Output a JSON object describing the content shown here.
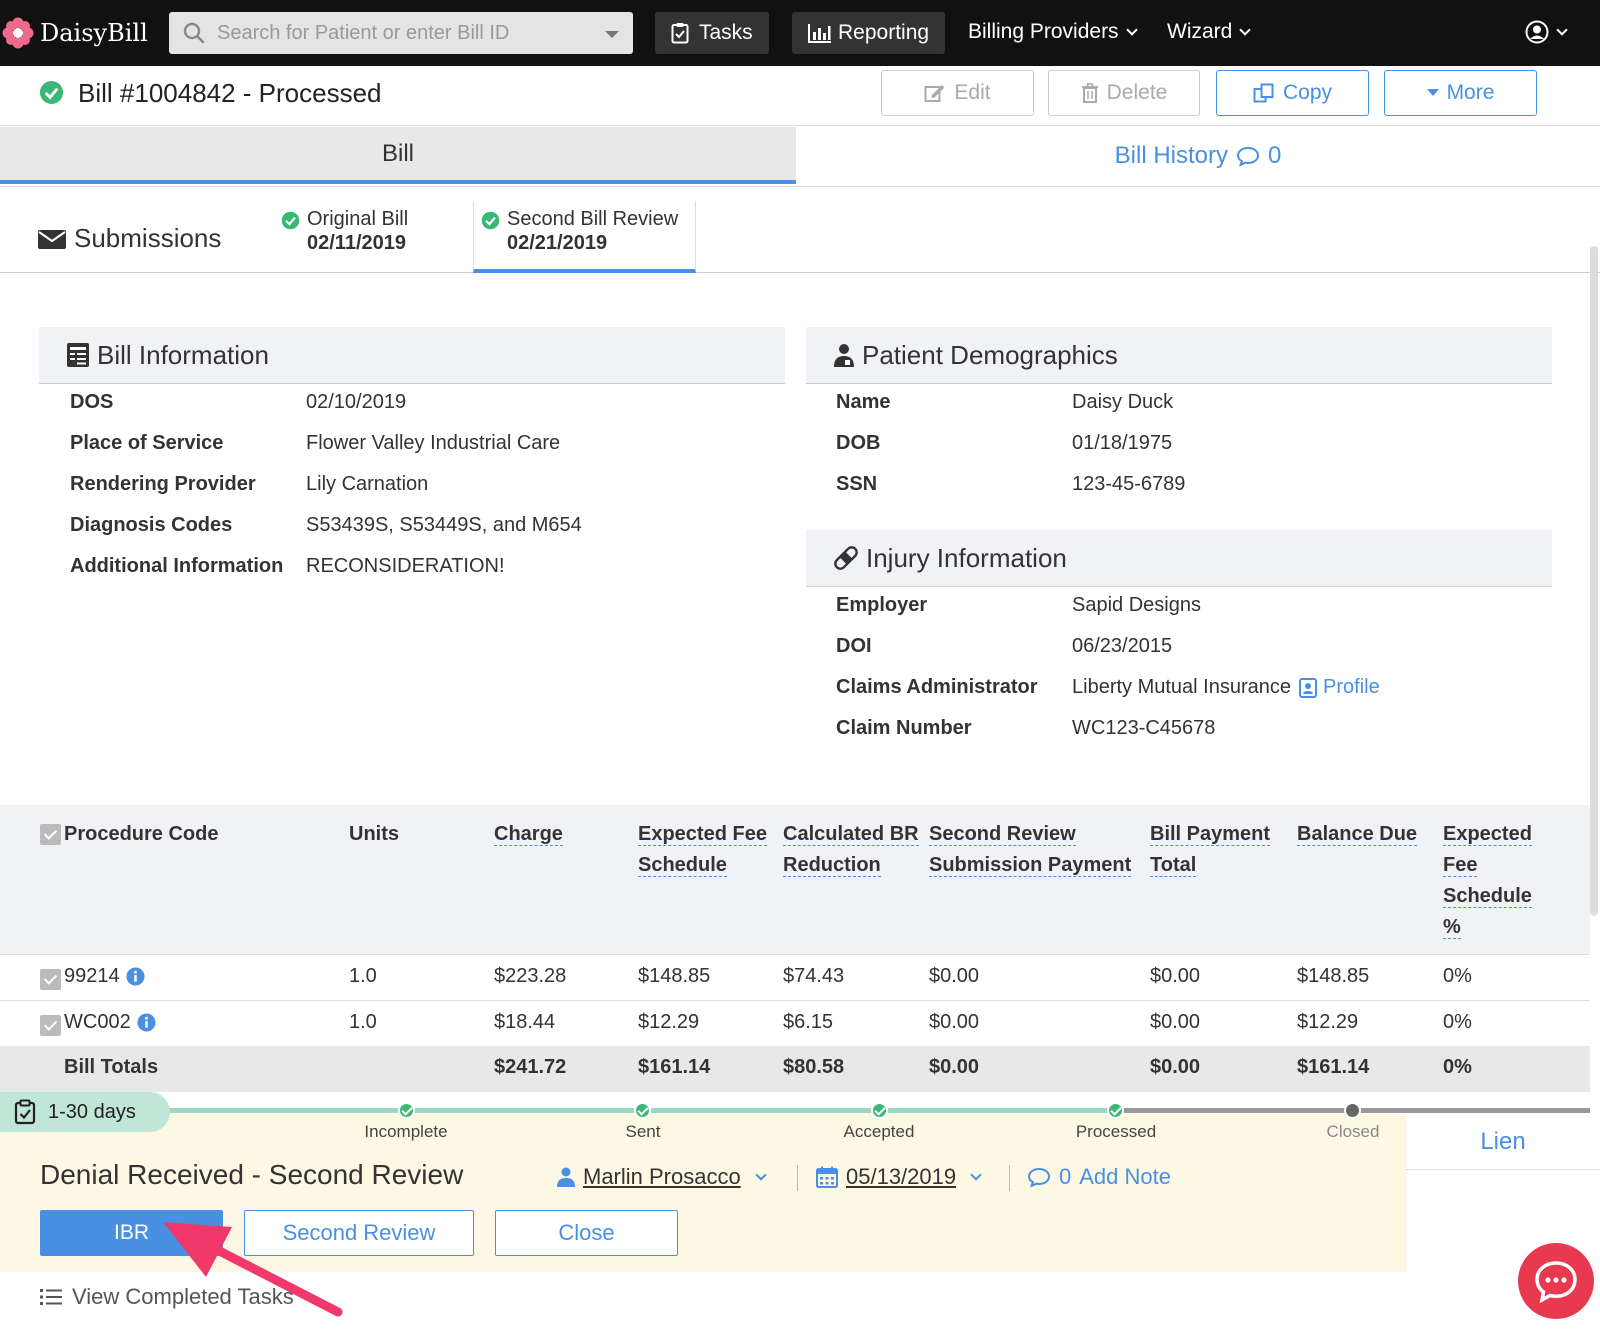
{
  "nav": {
    "brand": "DaisyBill",
    "search_placeholder": "Search for Patient or enter Bill ID",
    "tasks": "Tasks",
    "reporting": "Reporting",
    "billing_providers": "Billing Providers",
    "wizard": "Wizard"
  },
  "bill": {
    "title": "Bill #1004842 - Processed",
    "actions": {
      "edit": "Edit",
      "delete": "Delete",
      "copy": "Copy",
      "more": "More"
    }
  },
  "tabs": {
    "bill": "Bill",
    "history": "Bill History",
    "history_count": "0"
  },
  "submissions": {
    "label": "Submissions",
    "items": [
      {
        "name": "Original Bill",
        "date": "02/11/2019"
      },
      {
        "name": "Second Bill Review",
        "date": "02/21/2019"
      }
    ]
  },
  "bill_info": {
    "heading": "Bill Information",
    "rows": [
      {
        "label": "DOS",
        "value": "02/10/2019"
      },
      {
        "label": "Place of Service",
        "value": "Flower Valley Industrial Care"
      },
      {
        "label": "Rendering Provider",
        "value": "Lily Carnation"
      },
      {
        "label": "Diagnosis Codes",
        "value": "S53439S, S53449S, and M654"
      },
      {
        "label": "Additional Information",
        "value": "RECONSIDERATION!"
      }
    ]
  },
  "patient": {
    "heading": "Patient Demographics",
    "rows": [
      {
        "label": "Name",
        "value": "Daisy Duck"
      },
      {
        "label": "DOB",
        "value": "01/18/1975"
      },
      {
        "label": "SSN",
        "value": "123-45-6789"
      }
    ]
  },
  "injury": {
    "heading": "Injury Information",
    "rows": [
      {
        "label": "Employer",
        "value": "Sapid Designs"
      },
      {
        "label": "DOI",
        "value": "06/23/2015"
      },
      {
        "label": "Claims Administrator",
        "value": "Liberty Mutual Insurance"
      },
      {
        "label": "Claim Number",
        "value": "WC123-C45678"
      }
    ],
    "profile_link": "Profile"
  },
  "table": {
    "headers": {
      "procedure": "Procedure Code",
      "units": "Units",
      "charge": "Charge",
      "expected_1": "Expected Fee",
      "expected_2": "Schedule",
      "calc_1": "Calculated BR",
      "calc_2": "Reduction",
      "second_1": "Second Review",
      "second_2": "Submission Payment",
      "payment_1": "Bill Payment",
      "payment_2": "Total",
      "balance": "Balance Due",
      "pct_1": "Expected",
      "pct_2": "Fee",
      "pct_3": "Schedule",
      "pct_4": "%"
    },
    "rows": [
      {
        "code": "99214",
        "units": "1.0",
        "charge": "$223.28",
        "expected": "$148.85",
        "calc": "$74.43",
        "second": "$0.00",
        "payment": "$0.00",
        "balance": "$148.85",
        "pct": "0%"
      },
      {
        "code": "WC002",
        "units": "1.0",
        "charge": "$18.44",
        "expected": "$12.29",
        "calc": "$6.15",
        "second": "$0.00",
        "payment": "$0.00",
        "balance": "$12.29",
        "pct": "0%"
      }
    ],
    "totals": {
      "label": "Bill Totals",
      "charge": "$241.72",
      "expected": "$161.14",
      "calc": "$80.58",
      "second": "$0.00",
      "payment": "$0.00",
      "balance": "$161.14",
      "pct": "0%"
    }
  },
  "task": {
    "days": "1-30 days",
    "steps": [
      "Incomplete",
      "Sent",
      "Accepted",
      "Processed",
      "Closed"
    ],
    "lien_tab": "Lien",
    "title": "Denial Received - Second Review",
    "assignee": "Marlin Prosacco",
    "due_date": "05/13/2019",
    "note_count": "0",
    "note_label": "Add Note",
    "buttons": {
      "ibr": "IBR",
      "second_review": "Second Review",
      "close": "Close"
    },
    "completed_link": "View Completed Tasks"
  },
  "colors": {
    "accent": "#4a90e2",
    "success": "#3cb876",
    "annotation_arrow": "#f0386b",
    "chat": "#e83a4f"
  }
}
